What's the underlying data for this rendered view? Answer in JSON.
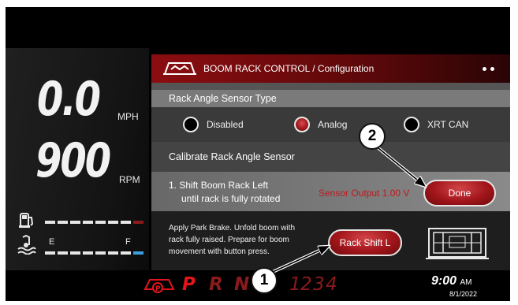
{
  "speed": {
    "value": "0.0",
    "unit": "MPH"
  },
  "rpm": {
    "value": "900",
    "unit": "RPM"
  },
  "fuel": {
    "empty_label": "E",
    "full_label": "F"
  },
  "dialog": {
    "title": "BOOM RACK CONTROL / Configuration",
    "sensor_type": {
      "heading": "Rack Angle Sensor Type",
      "options": [
        "Disabled",
        "Analog",
        "XRT CAN"
      ],
      "selected": "Analog"
    },
    "calibrate": {
      "heading": "Calibrate Rack Angle Sensor",
      "step_line1": "1. Shift Boom Rack Left",
      "step_line2": "until rack is fully rotated",
      "sensor_output": "Sensor Output 1.00 V",
      "done_button": "Done"
    },
    "instructions": {
      "line1": "Apply Park Brake.  Unfold boom with",
      "line2": "rack fully raised.  Prepare for boom",
      "line3": "movement with button press.",
      "button": "Rack Shift L"
    }
  },
  "callouts": [
    "1",
    "2"
  ],
  "status": {
    "gears": [
      "P",
      "R",
      "N",
      "1",
      "2",
      "3",
      "4"
    ],
    "active_gear": "P",
    "time": "9:00",
    "ampm": "AM",
    "date": "8/1/2022"
  },
  "colors": {
    "accent": "#a2161b",
    "gear_active": "#e0161b",
    "gear_inactive": "#8a1a1c",
    "fuel_bar_end": "#3aa0e0"
  },
  "icons": [
    "boom-rack-icon",
    "fuel-pump-icon",
    "coolant-temp-icon",
    "rack-diagram-icon",
    "park-brake-icon"
  ]
}
